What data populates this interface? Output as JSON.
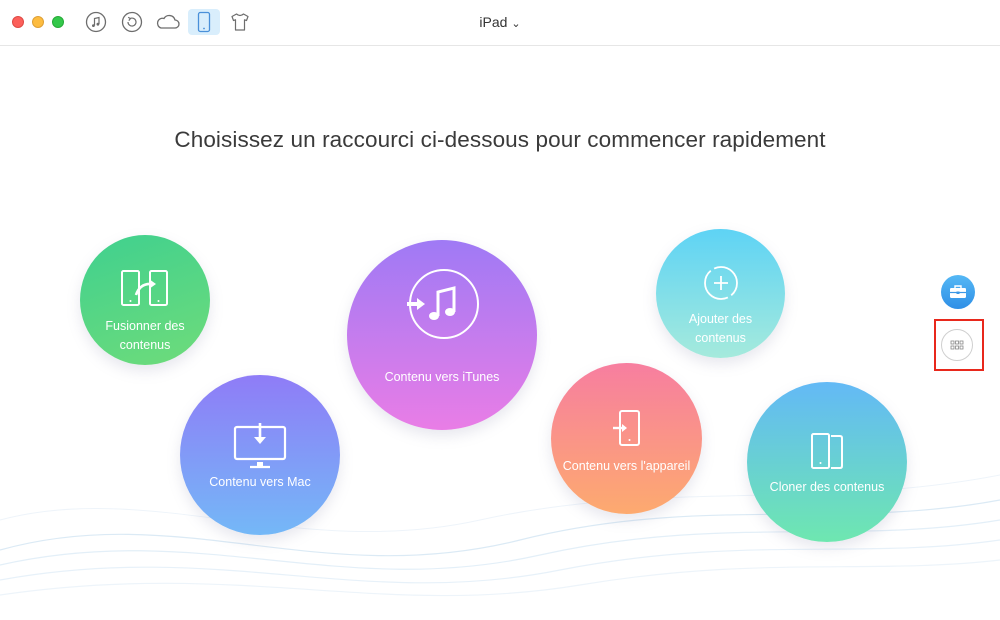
{
  "window": {
    "device_title": "iPad",
    "device_caret": "⌄"
  },
  "toolbar": {
    "items": [
      {
        "icon": "music-icon"
      },
      {
        "icon": "backup-restore-icon"
      },
      {
        "icon": "cloud-icon"
      },
      {
        "icon": "ipad-device-icon",
        "active": true
      },
      {
        "icon": "tshirt-icon"
      }
    ]
  },
  "main": {
    "headline": "Choisissez un raccourci ci-dessous pour commencer rapidement",
    "shortcuts": {
      "merge": {
        "label_line1": "Fusionner des",
        "label_line2": "contenus",
        "icon": "merge-icon"
      },
      "to_mac": {
        "label": "Contenu vers Mac",
        "icon": "monitor-download-icon"
      },
      "to_itunes": {
        "label": "Contenu vers iTunes",
        "icon": "itunes-transfer-icon"
      },
      "add": {
        "label_line1": "Ajouter des",
        "label_line2": "contenus",
        "icon": "add-crosshair-icon"
      },
      "to_device": {
        "label": "Contenu vers l'appareil",
        "icon": "device-import-icon"
      },
      "clone": {
        "label": "Cloner des contenus",
        "icon": "clone-devices-icon"
      }
    }
  },
  "sidebar": {
    "toolbox_icon": "toolbox-icon",
    "more_icon": "grid-dots-icon"
  },
  "colors": {
    "highlight": "#e8281c",
    "active_tab": "#d9eefc",
    "toolbar_icon": "#6d6d6d"
  }
}
